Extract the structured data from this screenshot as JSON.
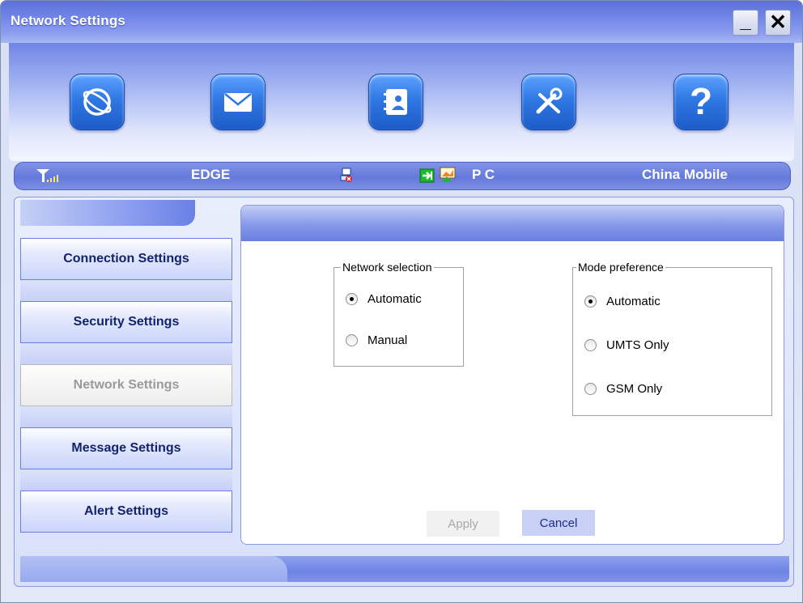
{
  "window": {
    "title": "Network Settings",
    "min_label": "_",
    "close_label": "✕"
  },
  "toolbar": {
    "buttons": [
      {
        "name": "internet-icon"
      },
      {
        "name": "messages-icon"
      },
      {
        "name": "contacts-icon"
      },
      {
        "name": "settings-tools-icon"
      },
      {
        "name": "help-icon",
        "label": "?"
      }
    ]
  },
  "status": {
    "network_type": "EDGE",
    "mode": "P C",
    "operator": "China Mobile",
    "icons": [
      "signal-strength-icon",
      "connection-status-icon",
      "sim-transfer-icon",
      "pc-mode-icon"
    ]
  },
  "sidebar": {
    "items": [
      {
        "label": "Connection Settings",
        "active": false
      },
      {
        "label": "Security Settings",
        "active": false
      },
      {
        "label": "Network Settings",
        "active": true
      },
      {
        "label": "Message Settings",
        "active": false
      },
      {
        "label": "Alert Settings",
        "active": false
      }
    ]
  },
  "network_selection": {
    "legend": "Network selection",
    "options": [
      {
        "label": "Automatic",
        "selected": true
      },
      {
        "label": "Manual",
        "selected": false
      }
    ]
  },
  "mode_preference": {
    "legend": "Mode preference",
    "options": [
      {
        "label": "Automatic",
        "selected": true
      },
      {
        "label": "UMTS Only",
        "selected": false
      },
      {
        "label": "GSM Only",
        "selected": false
      }
    ]
  },
  "actions": {
    "apply_label": "Apply",
    "cancel_label": "Cancel"
  },
  "colors": {
    "accent": "#6479db",
    "title_blue": "#5b6fd8",
    "nav_text": "#13236d"
  }
}
